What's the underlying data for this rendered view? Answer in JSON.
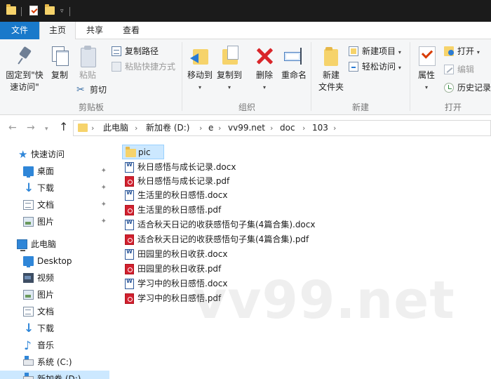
{
  "ribbon_tabs": {
    "file": "文件",
    "home": "主页",
    "share": "共享",
    "view": "查看"
  },
  "ribbon": {
    "clipboard": {
      "pin_quick_access_line1": "固定到\"快",
      "pin_quick_access_line2": "速访问\"",
      "copy": "复制",
      "paste": "粘贴",
      "copy_path": "复制路径",
      "paste_shortcut": "粘贴快捷方式",
      "cut": "剪切",
      "group_label": "剪贴板"
    },
    "organize": {
      "move_to": "移动到",
      "copy_to": "复制到",
      "delete": "删除",
      "rename": "重命名",
      "group_label": "组织"
    },
    "new": {
      "new_folder_line1": "新建",
      "new_folder_line2": "文件夹",
      "new_item": "新建项目",
      "easy_access": "轻松访问",
      "group_label": "新建"
    },
    "open": {
      "properties": "属性",
      "open": "打开",
      "edit": "编辑",
      "history": "历史记录",
      "group_label": "打开"
    }
  },
  "address_bar": {
    "breadcrumbs": [
      "此电脑",
      "新加卷 (D:)",
      "e",
      "vv99.net",
      "doc",
      "103"
    ]
  },
  "navigation_pane": {
    "quick_access": {
      "label": "快速访问",
      "items": [
        "桌面",
        "下载",
        "文档",
        "图片"
      ]
    },
    "this_pc": {
      "label": "此电脑",
      "items": [
        "Desktop",
        "视频",
        "图片",
        "文档",
        "下载",
        "音乐",
        "系统 (C:)",
        "新加卷 (D:)"
      ]
    }
  },
  "files": [
    {
      "name": "pic",
      "type": "folder"
    },
    {
      "name": "秋日感悟与成长记录.docx",
      "type": "docx"
    },
    {
      "name": "秋日感悟与成长记录.pdf",
      "type": "pdf"
    },
    {
      "name": "生活里的秋日感悟.docx",
      "type": "docx"
    },
    {
      "name": "生活里的秋日感悟.pdf",
      "type": "pdf"
    },
    {
      "name": "适合秋天日记的收获感悟句子集(4篇合集).docx",
      "type": "docx"
    },
    {
      "name": "适合秋天日记的收获感悟句子集(4篇合集).pdf",
      "type": "pdf"
    },
    {
      "name": "田园里的秋日收获.docx",
      "type": "docx"
    },
    {
      "name": "田园里的秋日收获.pdf",
      "type": "pdf"
    },
    {
      "name": "学习中的秋日感悟.docx",
      "type": "docx"
    },
    {
      "name": "学习中的秋日感悟.pdf",
      "type": "pdf"
    }
  ],
  "watermark": "vv99.net",
  "icons": {
    "folder": "folder-icon",
    "docx": "word-document-icon",
    "pdf": "pdf-document-icon",
    "pin": "pin-icon"
  },
  "colors": {
    "file_tab": "#1979ca",
    "selection": "#cce8ff",
    "folder": "#f6d36b",
    "pdf": "#d2202f",
    "word": "#2b579a"
  }
}
